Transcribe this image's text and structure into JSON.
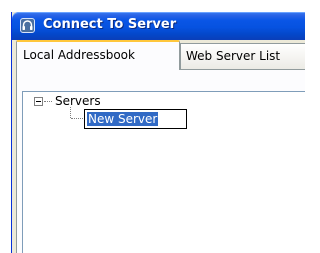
{
  "window": {
    "title": "Connect To Server",
    "icon": "headset-icon"
  },
  "tabs": [
    {
      "label": "Local Addressbook",
      "selected": true
    },
    {
      "label": "Web Server List",
      "selected": false
    }
  ],
  "tree": {
    "root": {
      "label": "Servers",
      "expanded": true,
      "children": [
        {
          "label": "New Server",
          "editing": true
        }
      ]
    }
  },
  "colors": {
    "title_bar": "#0652e0",
    "selection": "#316ac5",
    "tab_highlight": "#ffc73c"
  }
}
